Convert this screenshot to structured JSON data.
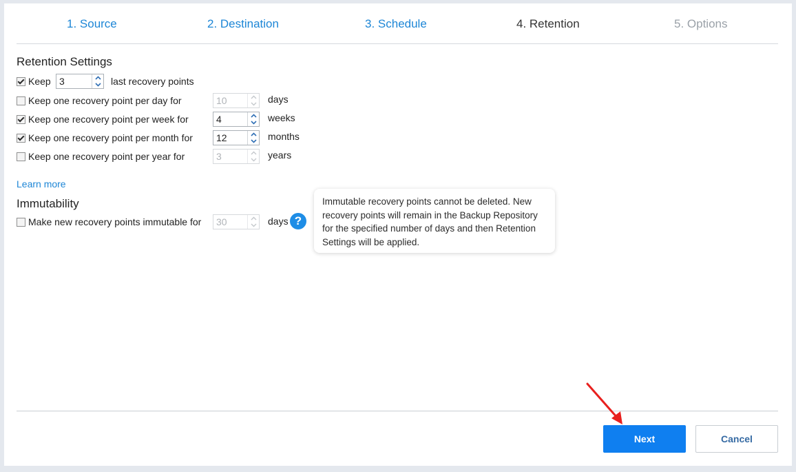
{
  "wizard": {
    "steps": [
      {
        "label": "1. Source",
        "state": "done"
      },
      {
        "label": "2. Destination",
        "state": "done"
      },
      {
        "label": "3. Schedule",
        "state": "done"
      },
      {
        "label": "4. Retention",
        "state": "current"
      },
      {
        "label": "5. Options",
        "state": "future"
      }
    ]
  },
  "retention": {
    "title": "Retention Settings",
    "keep_last": {
      "checked": true,
      "label": "Keep",
      "value": "3",
      "suffix": "last recovery points"
    },
    "per_day": {
      "checked": false,
      "label": "Keep one recovery point per day for",
      "value": "10",
      "unit": "days",
      "enabled": false
    },
    "per_week": {
      "checked": true,
      "label": "Keep one recovery point per week for",
      "value": "4",
      "unit": "weeks",
      "enabled": true
    },
    "per_month": {
      "checked": true,
      "label": "Keep one recovery point per month for",
      "value": "12",
      "unit": "months",
      "enabled": true
    },
    "per_year": {
      "checked": false,
      "label": "Keep one recovery point per year for",
      "value": "3",
      "unit": "years",
      "enabled": false
    }
  },
  "learn_more": "Learn more",
  "immutability": {
    "title": "Immutability",
    "label": "Make new recovery points immutable for",
    "checked": false,
    "value": "30",
    "unit": "days",
    "help_icon": "?",
    "tooltip": "Immutable recovery points cannot be deleted. New recovery points will remain in the Backup Repository for the specified number of days and then Retention Settings will be applied."
  },
  "footer": {
    "next_label": "Next",
    "cancel_label": "Cancel"
  },
  "colors": {
    "accent": "#1d86d6",
    "primary_button": "#0f7ff0",
    "annotation_arrow": "#e8201e"
  }
}
